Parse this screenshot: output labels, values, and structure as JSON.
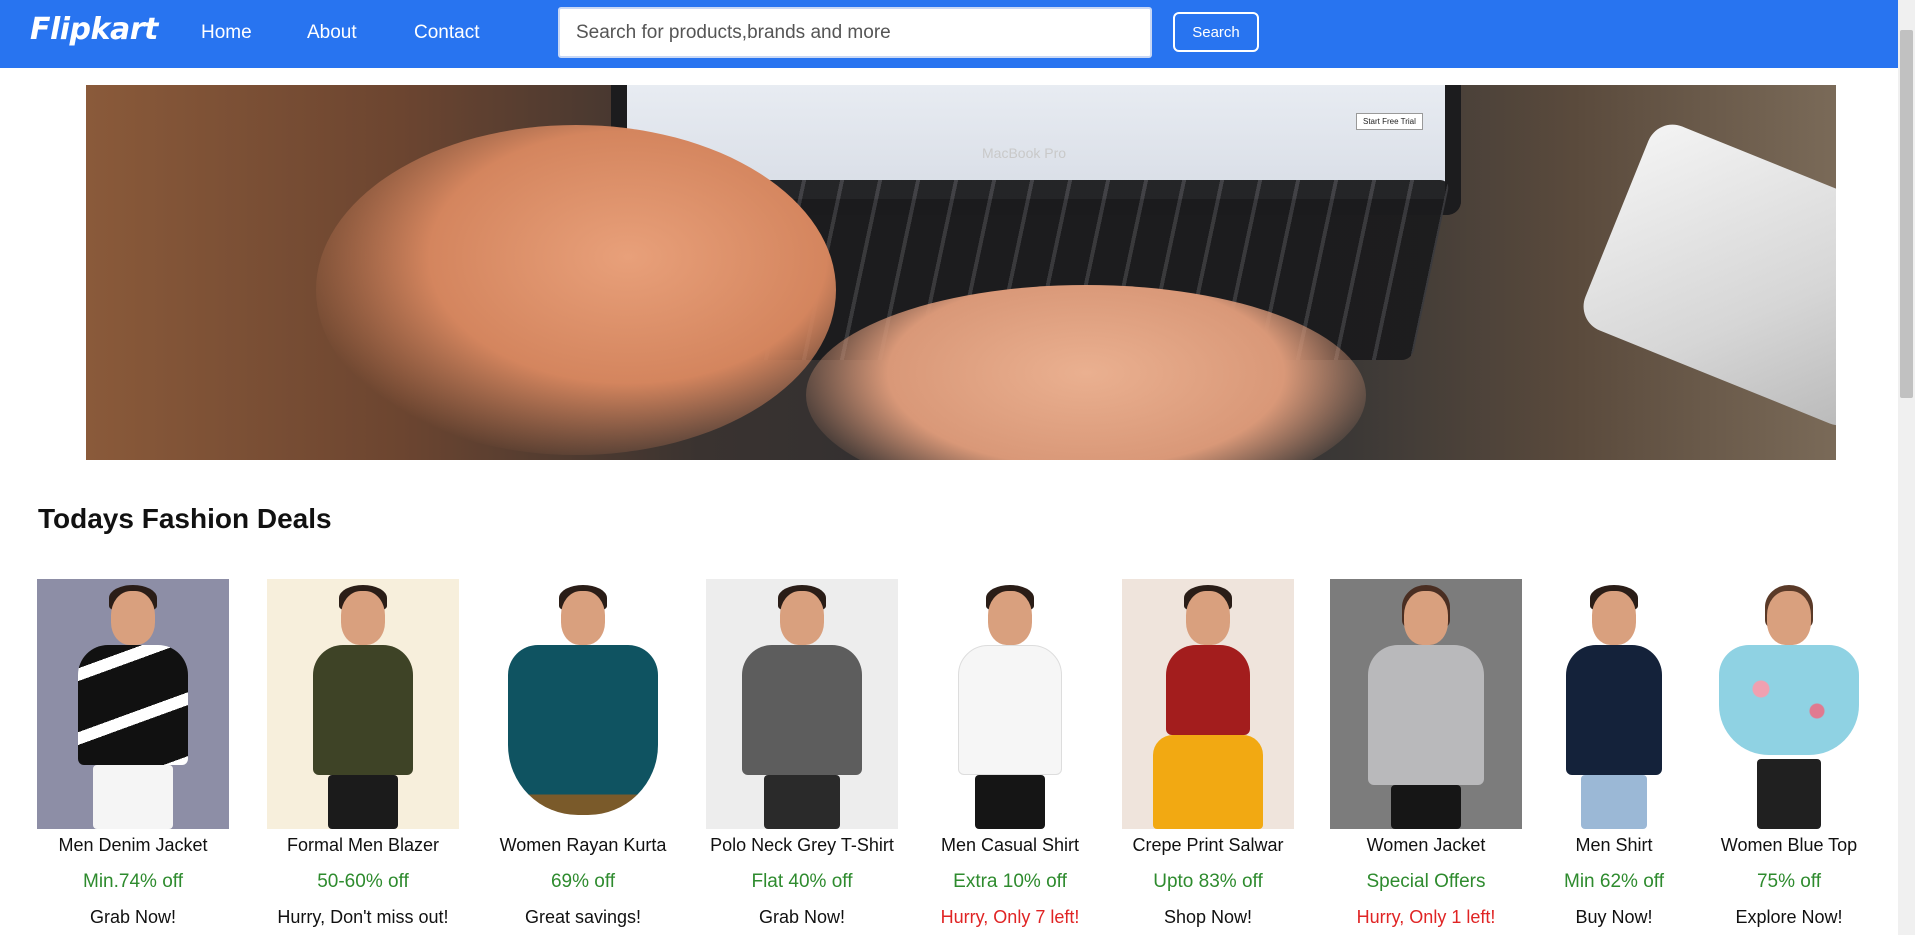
{
  "navbar": {
    "brand": "Flipkart",
    "links": [
      "Home",
      "About",
      "Contact"
    ],
    "search_placeholder": "Search for products,brands and more",
    "search_button": "Search"
  },
  "hero": {
    "laptop_label": "MacBook Pro",
    "chip_label": "Start Free Trial"
  },
  "section": {
    "title": "Todays Fashion Deals"
  },
  "products": [
    {
      "name": "Men Denim Jacket",
      "deal": "Min.74% off",
      "cta": "Grab Now!",
      "urgent": false
    },
    {
      "name": "Formal Men Blazer",
      "deal": "50-60% off",
      "cta": "Hurry, Don't miss out!",
      "urgent": false
    },
    {
      "name": "Women Rayan Kurta",
      "deal": "69% off",
      "cta": "Great savings!",
      "urgent": false
    },
    {
      "name": "Polo Neck Grey T-Shirt",
      "deal": "Flat 40% off",
      "cta": "Grab Now!",
      "urgent": false
    },
    {
      "name": "Men Casual Shirt",
      "deal": "Extra 10% off",
      "cta": "Hurry, Only 7 left!",
      "urgent": true
    },
    {
      "name": "Crepe Print Salwar",
      "deal": "Upto 83% off",
      "cta": "Shop Now!",
      "urgent": false
    },
    {
      "name": "Women Jacket",
      "deal": "Special Offers",
      "cta": "Hurry, Only 1 left!",
      "urgent": true
    },
    {
      "name": "Men Shirt",
      "deal": "Min 62% off",
      "cta": "Buy Now!",
      "urgent": false
    },
    {
      "name": "Women Blue Top",
      "deal": "75% off",
      "cta": "Explore Now!",
      "urgent": false
    }
  ],
  "colors": {
    "navbar": "#2874f0",
    "deal_green": "#2e8b2e",
    "urgent_red": "#e02424"
  }
}
